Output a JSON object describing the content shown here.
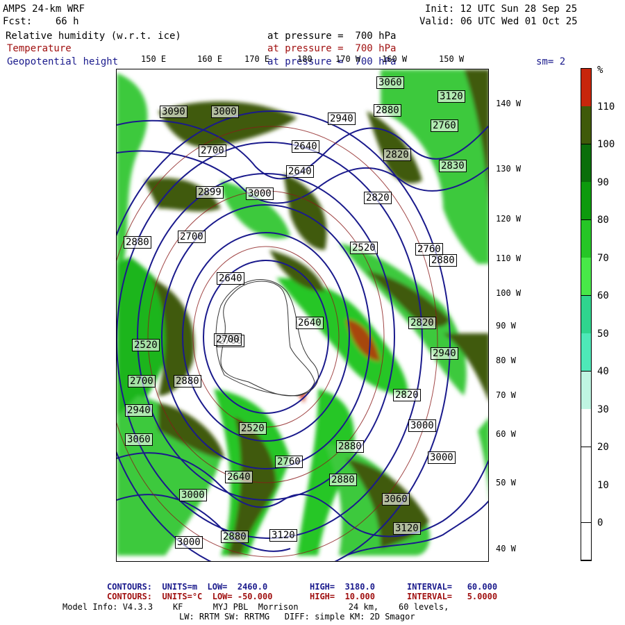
{
  "header": {
    "model_title": "AMPS 24-km WRF",
    "forecast": "Fcst:    66 h",
    "init": "Init: 12 UTC Sun 28 Sep 25",
    "valid": "Valid: 06 UTC Wed 01 Oct 25",
    "field1_name": "Relative humidity (w.r.t. ice)",
    "field1_level": "at pressure =  700 hPa",
    "field2_name": "Temperature",
    "field2_level": "at pressure =  700 hPa",
    "field3_name": "Geopotential height",
    "field3_level": "at pressure =  700 hPa",
    "smoothing": "sm= 2"
  },
  "longitude_labels": [
    "150 E",
    "160 E",
    "170 E",
    "180",
    "170 W",
    "160 W",
    "150 W"
  ],
  "latitude_ring_labels": [
    "140 W",
    "130 W",
    "120 W",
    "110 W",
    "100 W",
    "90 W",
    "80 W",
    "70 W",
    "60 W",
    "50 W",
    "40 W"
  ],
  "height_labels": [
    "3060",
    "3120",
    "3090",
    "3000",
    "2940",
    "2880",
    "2760",
    "2640",
    "2899",
    "2700",
    "2820",
    "2830",
    "2880",
    "3000",
    "2820",
    "2640",
    "2700",
    "2520",
    "2640",
    "2700",
    "2520",
    "2760",
    "2640",
    "2820",
    "2700",
    "2940",
    "3060",
    "2880",
    "3000",
    "3000",
    "2880",
    "2760",
    "2880",
    "2520",
    "2640",
    "3000",
    "2700",
    "2880",
    "3060",
    "3120",
    "2880",
    "2820",
    "3120",
    "2940",
    "3000"
  ],
  "colorbar": {
    "unit": "%",
    "labels": [
      "110",
      "100",
      "90",
      "80",
      "70",
      "60",
      "50",
      "40",
      "30",
      "20",
      "10",
      "0"
    ],
    "colors": [
      "#c8260c",
      "#3f5a0a",
      "#0b6e0b",
      "#0d9a0d",
      "#26c626",
      "#48e848",
      "#2fd58e",
      "#4ee8b8",
      "#bff5e2",
      "#ffffff",
      "#ffffff",
      "#ffffff",
      "#ffffff"
    ]
  },
  "footer": {
    "line1_a": "CONTOURS:  UNITS=m  LOW=  2460.0",
    "line1_b": "HIGH=  3180.0",
    "line1_c": "INTERVAL=   60.000",
    "line2_a": "CONTOURS:  UNITS=°C  LOW= -50.000",
    "line2_b": "HIGH=  10.000",
    "line2_c": "INTERVAL=   5.0000",
    "line3": "Model Info: V4.3.3    KF      MYJ PBL  Morrison          24 km,    60 levels,",
    "line4": "LW: RRTM SW: RRTMG   DIFF: simple KM: 2D Smagor"
  }
}
